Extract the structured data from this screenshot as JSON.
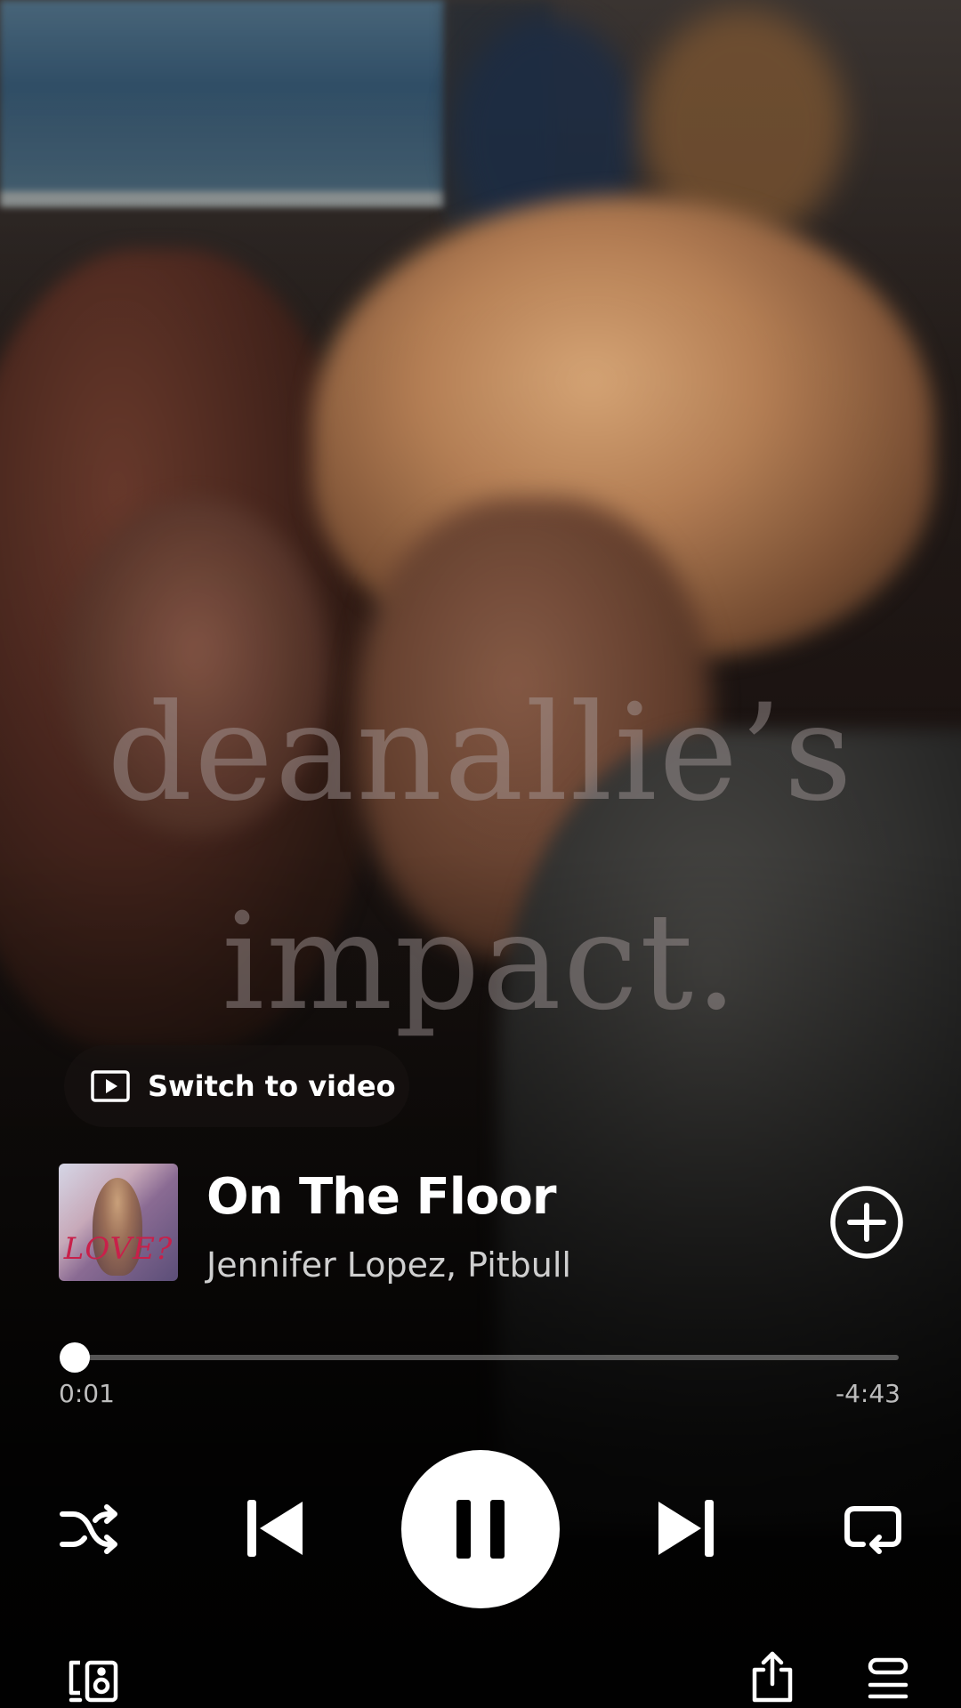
{
  "overlay_text": {
    "line1": "deanallie’s",
    "line2": "impact."
  },
  "switch_video": {
    "label": "Switch to video",
    "icon": "video-play-icon"
  },
  "track": {
    "title": "On The Floor",
    "artists": "Jennifer Lopez, Pitbull",
    "album_art_text": "LOVE?"
  },
  "playback": {
    "elapsed": "0:01",
    "remaining": "-4:43",
    "progress_fraction": 0.004,
    "state": "playing"
  },
  "controls": {
    "shuffle_icon": "shuffle-icon",
    "previous_icon": "skip-previous-icon",
    "play_pause_icon": "pause-icon",
    "next_icon": "skip-next-icon",
    "repeat_icon": "repeat-icon",
    "add_icon": "plus-circle-icon",
    "devices_icon": "connect-devices-icon",
    "share_icon": "share-icon",
    "queue_icon": "queue-icon"
  },
  "colors": {
    "accent": "#ffffff",
    "progress_track": "#5a5655"
  }
}
